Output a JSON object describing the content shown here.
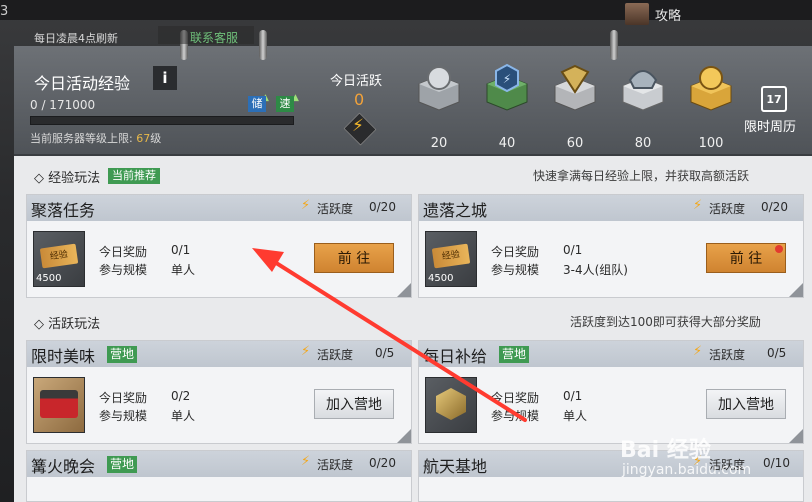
{
  "topbar": {
    "strategy_label": "攻略",
    "left_glyph": "3"
  },
  "header": {
    "refresh_note": "每日凌晨4点刷新",
    "service_link": "联系客服",
    "title": "今日活动经验",
    "info_label": "i",
    "exp_current": "0 / 171000",
    "store_badge": "储",
    "speed_badge": "速",
    "level_cap_prefix": "当前服务器等级上限: ",
    "level_cap_value": "67",
    "level_cap_suffix": "级",
    "today_activity_label": "今日活跃",
    "today_activity_value": "0",
    "milestones": [
      {
        "value": "20",
        "icon": "silver-coin-crate-icon"
      },
      {
        "value": "40",
        "icon": "lightning-crate-icon"
      },
      {
        "value": "60",
        "icon": "gold-badge-crate-icon"
      },
      {
        "value": "80",
        "icon": "armor-crate-icon"
      },
      {
        "value": "100",
        "icon": "gold-coin-crate-icon"
      }
    ],
    "weekly_day": "17",
    "weekly_label": "限时周历"
  },
  "exp_section": {
    "title": "经验玩法",
    "tag": "当前推荐",
    "desc": "快速拿满每日经验上限，并获取高额活跃"
  },
  "active_section": {
    "title": "活跃玩法",
    "desc": "活跃度到达100即可获得大部分奖励"
  },
  "labels": {
    "activity": "活跃度",
    "reward": "今日奖励",
    "scale": "参与规模"
  },
  "cards": [
    {
      "name": "聚落任务",
      "activity": "0/20",
      "reward": "0/1",
      "scale": "单人",
      "button": "前 往",
      "img_num": "4500",
      "img_text": "经验"
    },
    {
      "name": "遗落之城",
      "activity": "0/20",
      "reward": "0/1",
      "scale": "3-4人(组队)",
      "button": "前 往",
      "img_num": "4500",
      "img_text": "经验"
    },
    {
      "name": "限时美味",
      "tag": "营地",
      "activity": "0/5",
      "reward": "0/2",
      "scale": "单人",
      "button": "加入营地"
    },
    {
      "name": "每日补给",
      "tag": "营地",
      "activity": "0/5",
      "reward": "0/1",
      "scale": "单人",
      "button": "加入营地"
    },
    {
      "name": "篝火晚会",
      "tag": "营地",
      "activity": "0/20"
    },
    {
      "name": "航天基地",
      "activity": "0/10"
    }
  ],
  "watermark": {
    "main": "Bai 经验",
    "sub": "jingyan.baidu.com"
  }
}
